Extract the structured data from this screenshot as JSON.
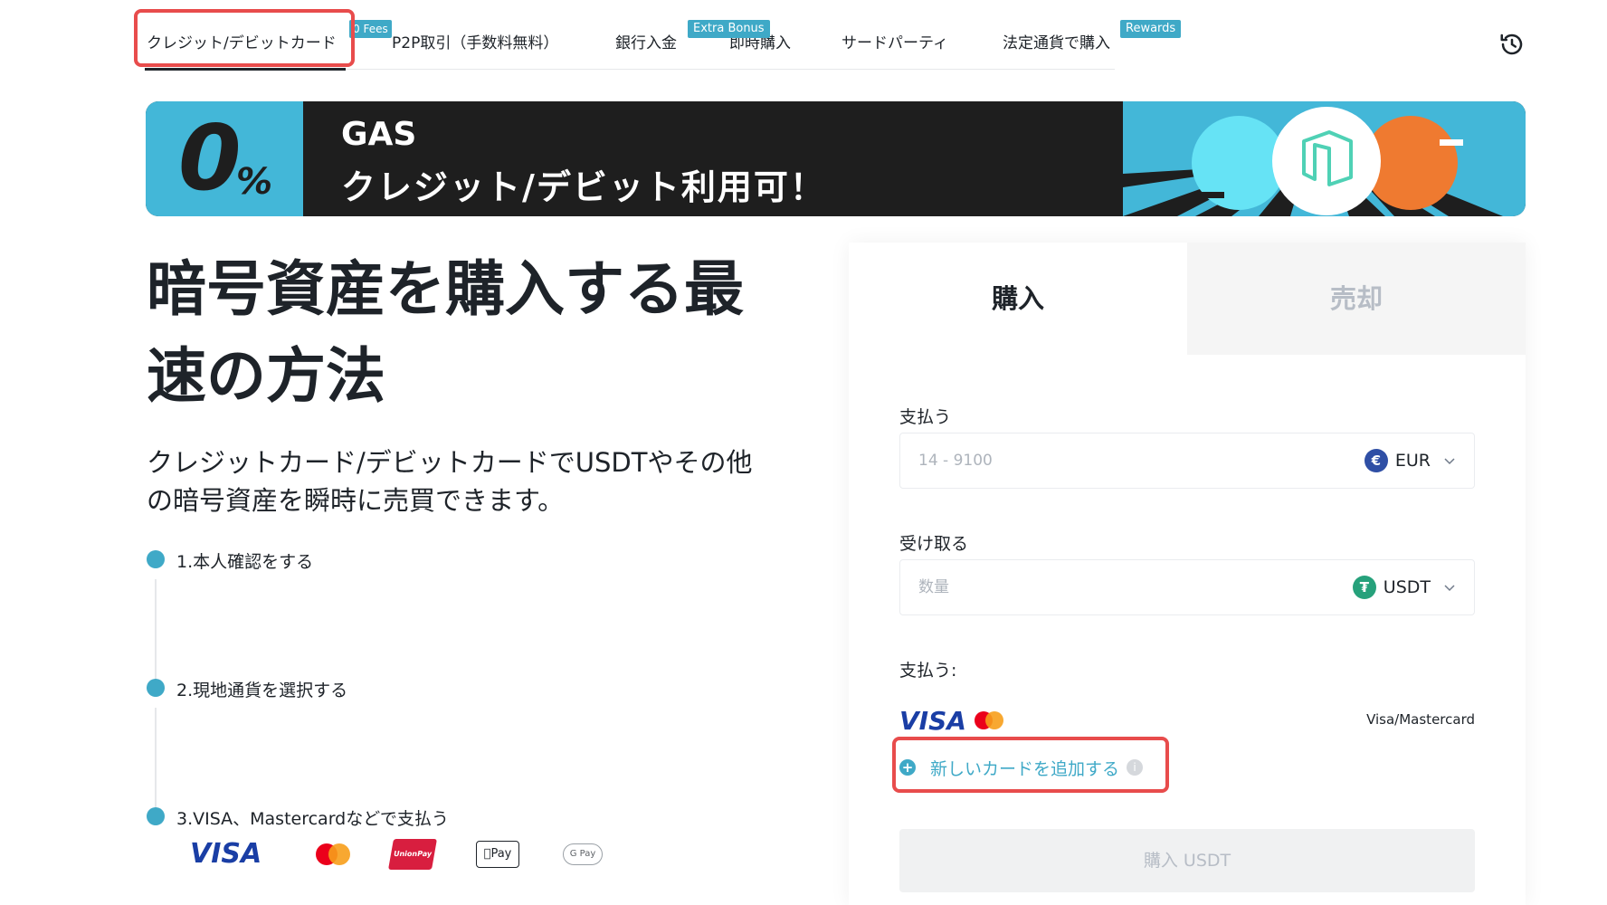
{
  "nav": {
    "tabs": [
      {
        "label": "クレジット/デビットカード"
      },
      {
        "label": "P2P取引（手数料無料）"
      },
      {
        "label": "銀行入金"
      },
      {
        "label": "即時購入"
      },
      {
        "label": "サードパーティ"
      },
      {
        "label": "法定通貨で購入"
      }
    ],
    "badges": {
      "p2p": "0 Fees",
      "instant": "Extra Bonus",
      "fiat": "Rewards"
    }
  },
  "banner": {
    "zero": "0",
    "percent": "%",
    "title_line1": "GAS",
    "title_line2": "クレジット/デビット利用可！"
  },
  "hero": {
    "title_line1": "暗号資産を購入する最",
    "title_line2": "速の方法",
    "subtitle_line1": "クレジットカード/デビットカードでUSDTやその他",
    "subtitle_line2": "の暗号資産を瞬時に売買できます。"
  },
  "steps": [
    {
      "label": "1.本人確認をする"
    },
    {
      "label": "2.現地通貨を選択する"
    },
    {
      "label": "3.VISA、Mastercardなどで支払う"
    }
  ],
  "payment_logos": {
    "visa": "VISA",
    "unionpay": "UnionPay",
    "applepay": "Pay",
    "googlepay": "G Pay"
  },
  "panel": {
    "tab_buy": "購入",
    "tab_sell": "売却",
    "pay_label": "支払う",
    "pay_placeholder": "14 - 9100",
    "pay_currency": "EUR",
    "receive_label": "受け取る",
    "receive_placeholder": "数量",
    "receive_currency": "USDT",
    "method_label": "支払う:",
    "card_brand": "VISA",
    "card_label": "Visa/Mastercard",
    "add_card": "新しいカードを追加する",
    "buy_button": "購入 USDT"
  },
  "colors": {
    "accent": "#3fa9c7",
    "highlight": "#e84c4c",
    "eur": "#2f4fa5",
    "usdt": "#26a17b"
  }
}
